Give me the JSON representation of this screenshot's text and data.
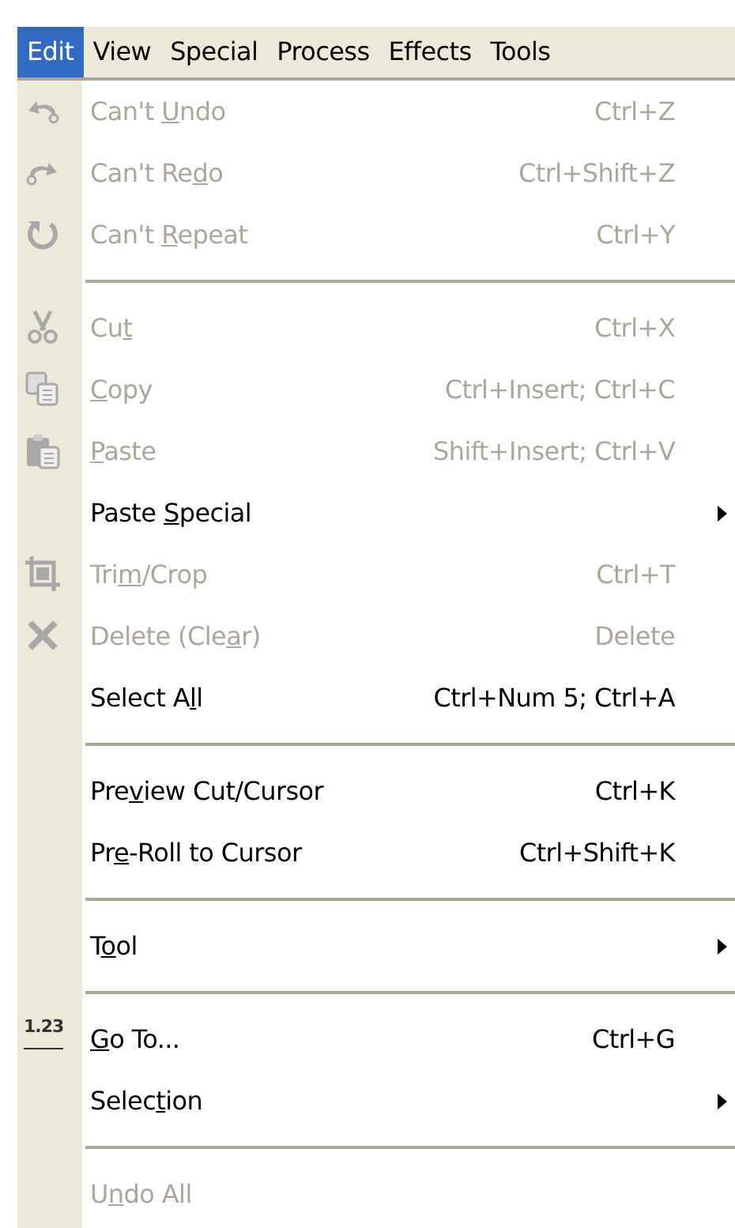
{
  "menubar": [
    {
      "label": "Edit",
      "selected": true
    },
    {
      "label": "View",
      "selected": false
    },
    {
      "label": "Special",
      "selected": false
    },
    {
      "label": "Process",
      "selected": false
    },
    {
      "label": "Effects",
      "selected": false
    },
    {
      "label": "Tools",
      "selected": false
    }
  ],
  "menu": [
    {
      "kind": "item",
      "label": {
        "before": "Can't ",
        "key": "U",
        "after": "ndo"
      },
      "shortcut": "Ctrl+Z",
      "disabled": true
    },
    {
      "kind": "item",
      "label": {
        "before": "Can't Re",
        "key": "d",
        "after": "o"
      },
      "shortcut": "Ctrl+Shift+Z",
      "disabled": true
    },
    {
      "kind": "item",
      "label": {
        "before": "Can't ",
        "key": "R",
        "after": "epeat"
      },
      "shortcut": "Ctrl+Y",
      "disabled": true
    },
    {
      "kind": "separator"
    },
    {
      "kind": "item",
      "label": {
        "before": "Cu",
        "key": "t"
      },
      "shortcut": "Ctrl+X",
      "disabled": true
    },
    {
      "kind": "item",
      "label": {
        "key": "C",
        "after": "opy"
      },
      "shortcut": "Ctrl+Insert; Ctrl+C",
      "disabled": true
    },
    {
      "kind": "item",
      "label": {
        "key": "P",
        "after": "aste"
      },
      "shortcut": "Shift+Insert; Ctrl+V",
      "disabled": true
    },
    {
      "kind": "submenu",
      "label": {
        "before": "Paste ",
        "key": "S",
        "after": "pecial"
      },
      "disabled": false
    },
    {
      "kind": "item",
      "label": {
        "before": "Tri",
        "key": "m",
        "after": "/Crop"
      },
      "shortcut": "Ctrl+T",
      "disabled": true
    },
    {
      "kind": "item",
      "label": {
        "before": "Delete (Cle",
        "key": "a",
        "after": "r)"
      },
      "shortcut": "Delete",
      "disabled": true
    },
    {
      "kind": "item",
      "label": {
        "before": "Select A",
        "key": "l",
        "after": "l"
      },
      "shortcut": "Ctrl+Num 5; Ctrl+A",
      "disabled": false
    },
    {
      "kind": "separator"
    },
    {
      "kind": "item",
      "label": {
        "before": "Pre",
        "key": "v",
        "after": "iew Cut/Cursor"
      },
      "shortcut": "Ctrl+K",
      "disabled": false
    },
    {
      "kind": "item",
      "label": {
        "before": "Pr",
        "key": "e",
        "after": "-Roll to Cursor"
      },
      "shortcut": "Ctrl+Shift+K",
      "disabled": false
    },
    {
      "kind": "separator"
    },
    {
      "kind": "submenu",
      "label": {
        "before": "T",
        "key": "o",
        "after": "ol"
      },
      "disabled": false
    },
    {
      "kind": "separator"
    },
    {
      "kind": "item",
      "icon_text": "1.23",
      "label": {
        "key": "G",
        "after": "o To..."
      },
      "shortcut": "Ctrl+G",
      "disabled": false
    },
    {
      "kind": "submenu",
      "label": {
        "before": "Selec",
        "key": "t",
        "after": "ion"
      },
      "disabled": false
    },
    {
      "kind": "separator"
    },
    {
      "kind": "item",
      "label": {
        "before": "U",
        "key": "n",
        "after": "do All"
      },
      "disabled": true
    }
  ]
}
